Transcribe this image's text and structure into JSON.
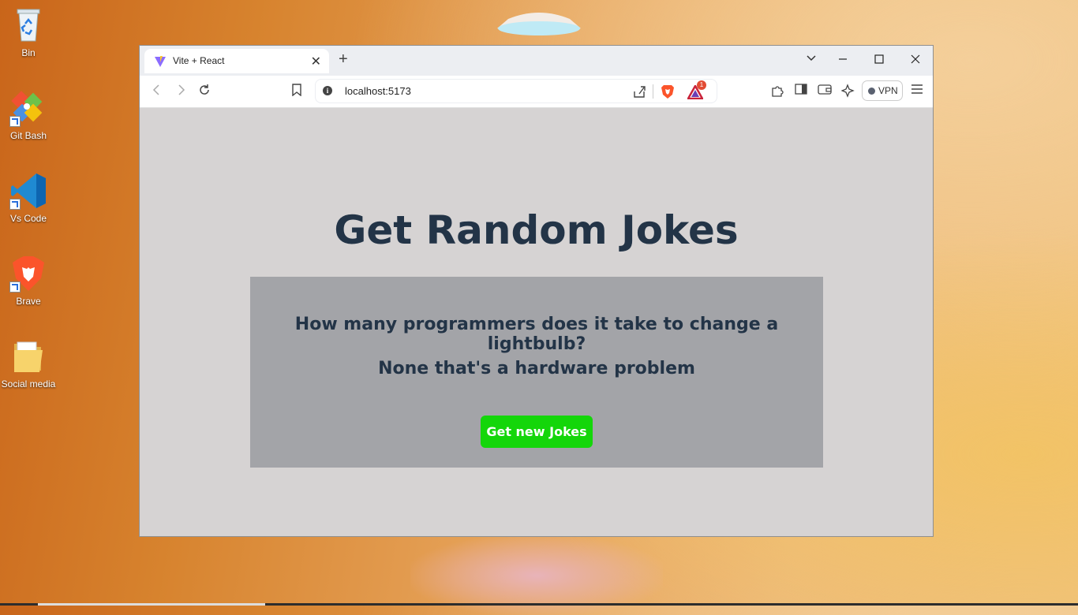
{
  "desktop": {
    "icons": [
      {
        "label": "Bin",
        "icon": "recycle-bin-icon"
      },
      {
        "label": "Git Bash",
        "icon": "git-bash-icon"
      },
      {
        "label": "Vs Code",
        "icon": "vscode-icon"
      },
      {
        "label": "Brave",
        "icon": "brave-icon"
      },
      {
        "label": "Social media",
        "icon": "folder-icon"
      }
    ]
  },
  "browser": {
    "tab": {
      "title": "Vite + React",
      "close": "✕"
    },
    "new_tab": "+",
    "address": "localhost:5173",
    "rewards_badge": "1",
    "vpn_label": "VPN"
  },
  "page": {
    "heading": "Get Random Jokes",
    "joke_setup": "How many programmers does it take to change a lightbulb?",
    "joke_punchline": "None that's a hardware problem",
    "button_label": "Get new Jokes"
  },
  "colors": {
    "heading": "#233447",
    "card": "#a3a4a8",
    "button": "#14d60a",
    "page_bg": "#d6d3d3"
  }
}
